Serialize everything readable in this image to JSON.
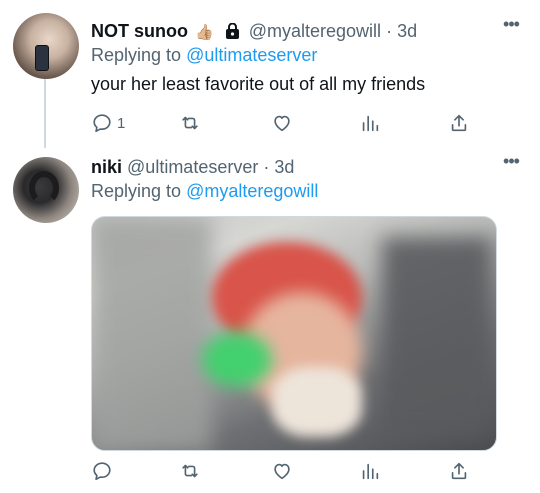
{
  "tweets": [
    {
      "name": "NOT sunoo",
      "emoji": "👍🏼",
      "handle": "@myalteregowill",
      "separator": "·",
      "time": "3d",
      "reply_prefix": "Replying to",
      "reply_to": "@ultimateserver",
      "text": "your her least favorite out of all my friends",
      "reply_count": "1",
      "protected": true
    },
    {
      "name": "niki",
      "handle": "@ultimateserver",
      "separator": "·",
      "time": "3d",
      "reply_prefix": "Replying to",
      "reply_to": "@myalteregowill",
      "has_media": true
    }
  ],
  "more_label": "•••",
  "colors": {
    "link": "#1d9bf0",
    "secondary_text": "#536471",
    "primary_text": "#0f1419",
    "thread_line": "#cfd9de"
  },
  "icons": [
    "reply-icon",
    "retweet-icon",
    "like-icon",
    "views-icon",
    "share-icon",
    "lock-icon",
    "more-icon"
  ]
}
